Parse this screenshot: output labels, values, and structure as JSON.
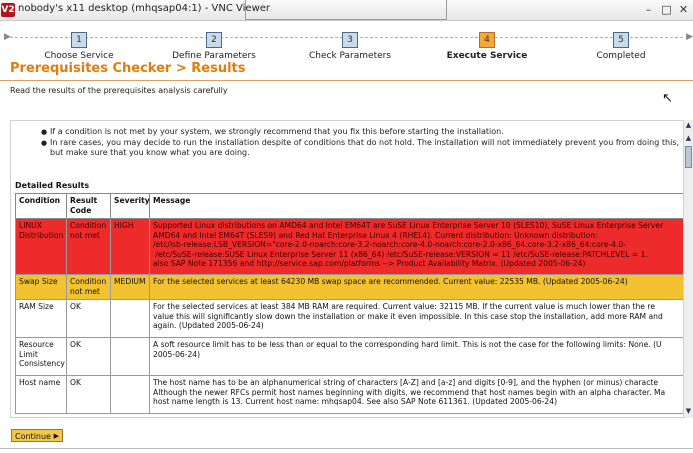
{
  "window": {
    "logo_text": "V2",
    "title": "nobody's x11 desktop (mhqsap04:1) - VNC Viewer",
    "minimize": "–",
    "maximize": "□",
    "close": "✕"
  },
  "wizard": {
    "steps": [
      {
        "num": "1",
        "label": "Choose Service"
      },
      {
        "num": "2",
        "label": "Define Parameters"
      },
      {
        "num": "3",
        "label": "Check Parameters"
      },
      {
        "num": "4",
        "label": "Execute Service"
      },
      {
        "num": "5",
        "label": "Completed"
      }
    ],
    "active_step": 4
  },
  "page": {
    "title": "Prerequisites Checker > Results",
    "instruction": "Read the results of the prerequisites analysis carefully"
  },
  "notes": [
    "If a condition is not met by your system, we strongly recommend that you fix this before starting the installation.",
    "In rare cases, you may decide to run the installation despite of conditions that do not hold. The installation will not immediately prevent you from doing this, but make sure that you know what you are doing."
  ],
  "results": {
    "heading": "Detailed Results",
    "columns": [
      "Condition",
      "Result Code",
      "Severity",
      "Message"
    ],
    "rows": [
      {
        "condition": "LINUX Distribution",
        "result": "Condition not met",
        "severity": "HIGH",
        "message": "Supported Linux distributions on AMD64 and Intel EM64T are SuSE Linux Enterprise Server 10 (SLES10), SuSE Linux Enterprise Server\nAMD64 and Intel EM64T (SLES9) and Red Hat Enterprise Linux 4 (RHEL4). Current distribution: Unknown distribution:\n/etc/lsb-release:LSB_VERSION=\"core-2.0-noarch:core-3.2-noarch:core-4.0-noarch:core-2.0-x86_64:core-3.2-x86_64:core-4.0-\n /etc/SuSE-release:SUSE Linux Enterprise Server 11 (x86_64) /etc/SuSE-release:VERSION = 11 /etc/SuSE-release:PATCHLEVEL = 1.\nalso SAP Note 171356 and http://service.sap.com/platforms --> Product Availability Matrix. (Updated 2005-06-24)"
      },
      {
        "condition": "Swap Size",
        "result": "Condition not met",
        "severity": "MEDIUM",
        "message": "For the selected services at least 64230 MB swap space are recommended. Current value: 22535 MB. (Updated 2005-06-24)"
      },
      {
        "condition": "RAM Size",
        "result": "OK",
        "severity": "",
        "message": "For the selected services at least 384 MB RAM are required. Current value: 32115 MB. If the current value is much lower than the re\nvalue this will significantly slow down the installation or make it even impossible. In this case stop the installation, add more RAM and\nagain. (Updated 2005-06-24)"
      },
      {
        "condition": "Resource Limit Consistency",
        "result": "OK",
        "severity": "",
        "message": "A soft resource limit has to be less than or equal to the corresponding hard limit. This is not the case for the following limits: None. (U\n2005-06-24)"
      },
      {
        "condition": "Host name",
        "result": "OK",
        "severity": "",
        "message": "The host name has to be an alphanumerical string of characters [A-Z] and [a-z] and digits [0-9], and the hyphen (or minus) characte\nAlthough the newer RFCs permit host names beginning with digits, we recommend that host names begin with an alpha character. Ma\nhost name length is 13. Current host name: mhqsap04. See also SAP Note 611361. (Updated 2005-06-24)"
      }
    ]
  },
  "footer": {
    "continue_label": "Continue",
    "continue_arrow": "▶"
  },
  "colors": {
    "accent_orange": "#e07c10",
    "severity_high": "#ee2b2b",
    "severity_medium": "#f3c230",
    "active_step": "#f2a83a"
  }
}
